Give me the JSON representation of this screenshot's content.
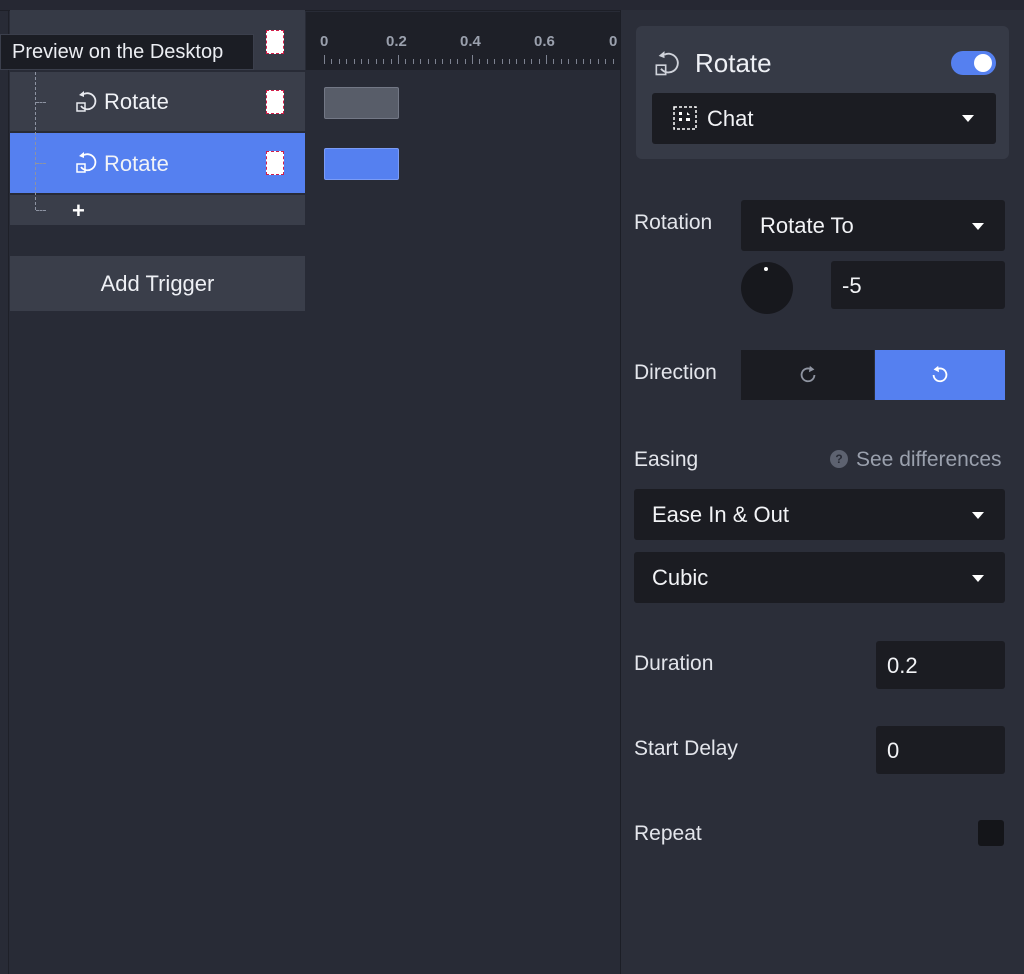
{
  "tooltip": "Preview on the Desktop",
  "tree": {
    "items": [
      {
        "label": "Rotate",
        "selected": false
      },
      {
        "label": "Rotate",
        "selected": true
      }
    ],
    "add_symbol": "+",
    "add_trigger_label": "Add Trigger"
  },
  "timeline": {
    "ticks": [
      "0",
      "0.2",
      "0.4",
      "0.6",
      "0"
    ]
  },
  "inspector": {
    "title": "Rotate",
    "enabled": true,
    "target": "Chat",
    "rotation_label": "Rotation",
    "rotation_mode": "Rotate To",
    "rotation_value": "-5",
    "direction_label": "Direction",
    "direction_selected": "counterclockwise",
    "easing_label": "Easing",
    "help_glyph": "?",
    "see_differences": "See differences",
    "easing_type": "Ease In & Out",
    "easing_curve": "Cubic",
    "duration_label": "Duration",
    "duration_value": "0.2",
    "start_delay_label": "Start Delay",
    "start_delay_value": "0",
    "repeat_label": "Repeat",
    "repeat_checked": false
  },
  "colors": {
    "accent": "#5580f0",
    "panel": "#2b2e39",
    "field": "#1b1c22"
  }
}
